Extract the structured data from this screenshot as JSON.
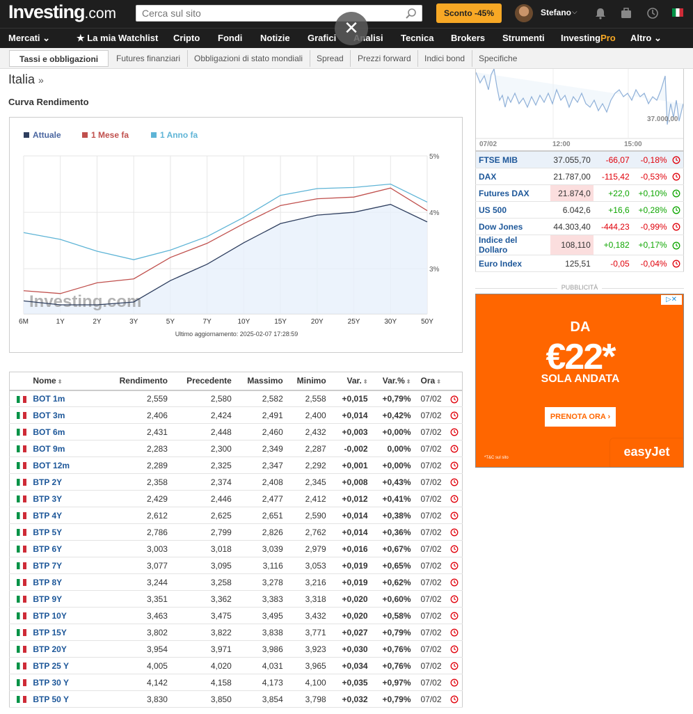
{
  "header": {
    "logo_main": "Investing",
    "logo_suffix": ".com",
    "search_placeholder": "Cerca sul sito",
    "promo_label": "Sconto -45%",
    "username": "Stefano",
    "user_chevron": "⌵"
  },
  "nav": {
    "items": [
      "Mercati ⌄",
      "★  La mia Watchlist",
      "Cripto",
      "Fondi",
      "Notizie",
      "Grafici",
      "Analisi",
      "Tecnica",
      "Brokers",
      "Strumenti",
      "InvestingPro",
      "Altro ⌄"
    ]
  },
  "overlay": {
    "close_glyph": "✕"
  },
  "subnav": {
    "active": "Tassi e obbligazioni",
    "items": [
      "Futures finanziari",
      "Obbligazioni di stato mondiali",
      "Spread",
      "Prezzi forward",
      "Indici bond",
      "Specifiche"
    ]
  },
  "page": {
    "title": "Italia",
    "title_arrow": "»",
    "section_title": "Curva Rendimento"
  },
  "chart_data": {
    "type": "line",
    "title": "",
    "watermark": "Investing.com",
    "categories": [
      "6M",
      "1Y",
      "2Y",
      "3Y",
      "5Y",
      "7Y",
      "10Y",
      "15Y",
      "20Y",
      "25Y",
      "30Y",
      "50Y"
    ],
    "y_ticks": [
      "5%",
      "4%",
      "3%"
    ],
    "ylim": [
      2.2,
      5.0
    ],
    "grid": true,
    "legend_position": "top-left",
    "series": [
      {
        "name": "Attuale",
        "color": "#2e3e5e",
        "values": [
          2.43,
          2.36,
          2.36,
          2.41,
          2.79,
          3.08,
          3.46,
          3.8,
          3.95,
          4.0,
          4.14,
          3.83
        ]
      },
      {
        "name": "1 Mese fa",
        "color": "#c0504d",
        "values": [
          2.61,
          2.56,
          2.75,
          2.82,
          3.2,
          3.45,
          3.8,
          4.12,
          4.24,
          4.27,
          4.43,
          4.03
        ]
      },
      {
        "name": "1 Anno fa",
        "color": "#5eb4d6",
        "values": [
          3.64,
          3.52,
          3.31,
          3.16,
          3.33,
          3.57,
          3.91,
          4.3,
          4.42,
          4.44,
          4.5,
          4.18
        ]
      }
    ],
    "updated": "Ultimo aggiornamento: 2025-02-07 17:28:59"
  },
  "table": {
    "headers": [
      "Nome",
      "Rendimento",
      "Precedente",
      "Massimo",
      "Minimo",
      "Var.",
      "Var.%",
      "Ora"
    ],
    "rows": [
      {
        "name": "BOT 1m",
        "yield": "2,559",
        "prev": "2,580",
        "high": "2,582",
        "low": "2,558",
        "chg": "+0,015",
        "pct": "+0,79%",
        "time": "07/02",
        "dir": "pos"
      },
      {
        "name": "BOT 3m",
        "yield": "2,406",
        "prev": "2,424",
        "high": "2,491",
        "low": "2,400",
        "chg": "+0,014",
        "pct": "+0,42%",
        "time": "07/02",
        "dir": "pos"
      },
      {
        "name": "BOT 6m",
        "yield": "2,431",
        "prev": "2,448",
        "high": "2,460",
        "low": "2,432",
        "chg": "+0,003",
        "pct": "+0,00%",
        "time": "07/02",
        "dir": "pos"
      },
      {
        "name": "BOT 9m",
        "yield": "2,283",
        "prev": "2,300",
        "high": "2,349",
        "low": "2,287",
        "chg": "-0,002",
        "pct": "0,00%",
        "time": "07/02",
        "dir": "neg"
      },
      {
        "name": "BOT 12m",
        "yield": "2,289",
        "prev": "2,325",
        "high": "2,347",
        "low": "2,292",
        "chg": "+0,001",
        "pct": "+0,00%",
        "time": "07/02",
        "dir": "pos"
      },
      {
        "name": "BTP 2Y",
        "yield": "2,358",
        "prev": "2,374",
        "high": "2,408",
        "low": "2,345",
        "chg": "+0,008",
        "pct": "+0,43%",
        "time": "07/02",
        "dir": "pos"
      },
      {
        "name": "BTP 3Y",
        "yield": "2,429",
        "prev": "2,446",
        "high": "2,477",
        "low": "2,412",
        "chg": "+0,012",
        "pct": "+0,41%",
        "time": "07/02",
        "dir": "pos"
      },
      {
        "name": "BTP 4Y",
        "yield": "2,612",
        "prev": "2,625",
        "high": "2,651",
        "low": "2,590",
        "chg": "+0,014",
        "pct": "+0,38%",
        "time": "07/02",
        "dir": "pos"
      },
      {
        "name": "BTP 5Y",
        "yield": "2,786",
        "prev": "2,799",
        "high": "2,826",
        "low": "2,762",
        "chg": "+0,014",
        "pct": "+0,36%",
        "time": "07/02",
        "dir": "pos"
      },
      {
        "name": "BTP 6Y",
        "yield": "3,003",
        "prev": "3,018",
        "high": "3,039",
        "low": "2,979",
        "chg": "+0,016",
        "pct": "+0,67%",
        "time": "07/02",
        "dir": "pos"
      },
      {
        "name": "BTP 7Y",
        "yield": "3,077",
        "prev": "3,095",
        "high": "3,116",
        "low": "3,053",
        "chg": "+0,019",
        "pct": "+0,65%",
        "time": "07/02",
        "dir": "pos"
      },
      {
        "name": "BTP 8Y",
        "yield": "3,244",
        "prev": "3,258",
        "high": "3,278",
        "low": "3,216",
        "chg": "+0,019",
        "pct": "+0,62%",
        "time": "07/02",
        "dir": "pos"
      },
      {
        "name": "BTP 9Y",
        "yield": "3,351",
        "prev": "3,362",
        "high": "3,383",
        "low": "3,318",
        "chg": "+0,020",
        "pct": "+0,60%",
        "time": "07/02",
        "dir": "pos"
      },
      {
        "name": "BTP 10Y",
        "yield": "3,463",
        "prev": "3,475",
        "high": "3,495",
        "low": "3,432",
        "chg": "+0,020",
        "pct": "+0,58%",
        "time": "07/02",
        "dir": "pos"
      },
      {
        "name": "BTP 15Y",
        "yield": "3,802",
        "prev": "3,822",
        "high": "3,838",
        "low": "3,771",
        "chg": "+0,027",
        "pct": "+0,79%",
        "time": "07/02",
        "dir": "pos"
      },
      {
        "name": "BTP 20Y",
        "yield": "3,954",
        "prev": "3,971",
        "high": "3,986",
        "low": "3,923",
        "chg": "+0,030",
        "pct": "+0,76%",
        "time": "07/02",
        "dir": "pos"
      },
      {
        "name": "BTP 25 Y",
        "yield": "4,005",
        "prev": "4,020",
        "high": "4,031",
        "low": "3,965",
        "chg": "+0,034",
        "pct": "+0,76%",
        "time": "07/02",
        "dir": "pos"
      },
      {
        "name": "BTP 30 Y",
        "yield": "4,142",
        "prev": "4,158",
        "high": "4,173",
        "low": "4,100",
        "chg": "+0,035",
        "pct": "+0,97%",
        "time": "07/02",
        "dir": "pos"
      },
      {
        "name": "BTP 50 Y",
        "yield": "3,830",
        "prev": "3,850",
        "high": "3,854",
        "low": "3,798",
        "chg": "+0,032",
        "pct": "+0,79%",
        "time": "07/02",
        "dir": "pos"
      }
    ]
  },
  "side": {
    "mini_chart_labels": {
      "d1": "07/02",
      "d2": "12:00",
      "d3": "15:00",
      "level": "37.000,00"
    },
    "indices": [
      {
        "name": "FTSE MIB",
        "last": "37.055,70",
        "chg": "-66,07",
        "pct": "-0,18%",
        "dir": "neg",
        "hl_row": true,
        "hl_last": false
      },
      {
        "name": "DAX",
        "last": "21.787,00",
        "chg": "-115,42",
        "pct": "-0,53%",
        "dir": "neg",
        "hl_row": false,
        "hl_last": false
      },
      {
        "name": "Futures DAX",
        "last": "21.874,0",
        "chg": "+22,0",
        "pct": "+0,10%",
        "dir": "pos",
        "hl_row": false,
        "hl_last": true
      },
      {
        "name": "US 500",
        "last": "6.042,6",
        "chg": "+16,6",
        "pct": "+0,28%",
        "dir": "pos",
        "hl_row": false,
        "hl_last": false
      },
      {
        "name": "Dow Jones",
        "last": "44.303,40",
        "chg": "-444,23",
        "pct": "-0,99%",
        "dir": "neg",
        "hl_row": false,
        "hl_last": false
      },
      {
        "name": "Indice del Dollaro",
        "last": "108,110",
        "chg": "+0,182",
        "pct": "+0,17%",
        "dir": "pos",
        "hl_row": false,
        "hl_last": true
      },
      {
        "name": "Euro Index",
        "last": "125,51",
        "chg": "-0,05",
        "pct": "-0,04%",
        "dir": "neg",
        "hl_row": false,
        "hl_last": false
      }
    ],
    "pub_label": "PUBBLICITÀ"
  },
  "ad": {
    "da": "DA",
    "price": "€22*",
    "sola": "SOLA ANDATA",
    "button": "PRENOTA ORA ›",
    "tc": "*T&C sul sito",
    "brand": "easyJet",
    "choice": "▷✕"
  },
  "colors": {
    "accent": "#f7a825",
    "positive": "#0ea600",
    "negative": "#e0000a",
    "link": "#1d5799",
    "ad": "#ff6600"
  }
}
